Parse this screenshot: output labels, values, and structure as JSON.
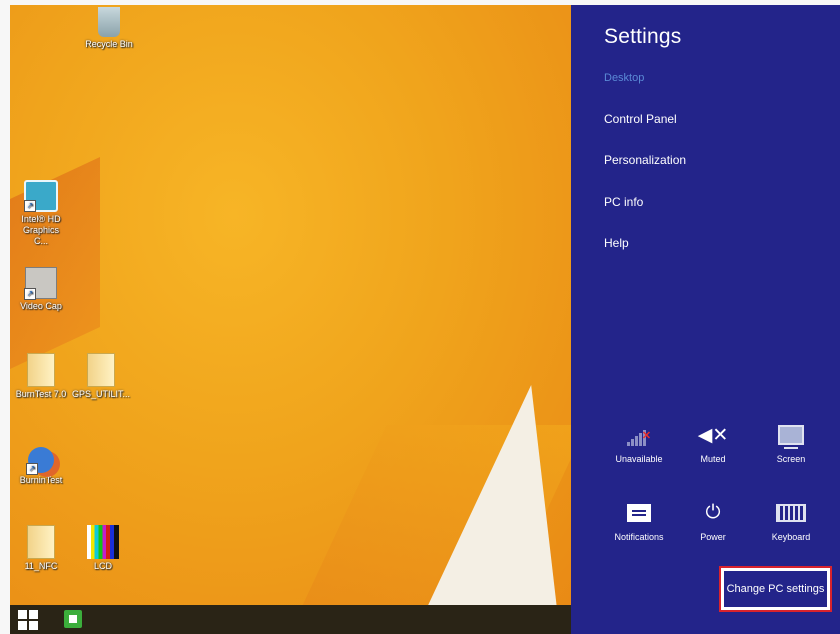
{
  "desktop": {
    "icons": [
      {
        "label": "Recycle Bin"
      },
      {
        "label": "Intel® HD Graphics C..."
      },
      {
        "label": "Video Cap"
      },
      {
        "label": "BurnTest 7.0"
      },
      {
        "label": "GPS_UTILIT..."
      },
      {
        "label": "BurninTest"
      },
      {
        "label": "11_NFC"
      },
      {
        "label": "LCD"
      }
    ]
  },
  "taskbar": {
    "start_icon": "windows-logo-icon",
    "store_icon": "store-icon"
  },
  "settings": {
    "title": "Settings",
    "context": "Desktop",
    "menu": [
      "Control Panel",
      "Personalization",
      "PC info",
      "Help"
    ],
    "quick": [
      {
        "label": "Unavailable",
        "icon": "network-unavailable-icon"
      },
      {
        "label": "Muted",
        "icon": "volume-muted-icon"
      },
      {
        "label": "Screen",
        "icon": "screen-icon"
      },
      {
        "label": "Notifications",
        "icon": "notifications-icon"
      },
      {
        "label": "Power",
        "icon": "power-icon"
      },
      {
        "label": "Keyboard",
        "icon": "keyboard-icon"
      }
    ],
    "change_pc_settings": "Change PC settings",
    "colors": {
      "charm_background": "#23248a",
      "context_text": "#5b8ad6",
      "highlight_border": "#d9232d"
    }
  }
}
